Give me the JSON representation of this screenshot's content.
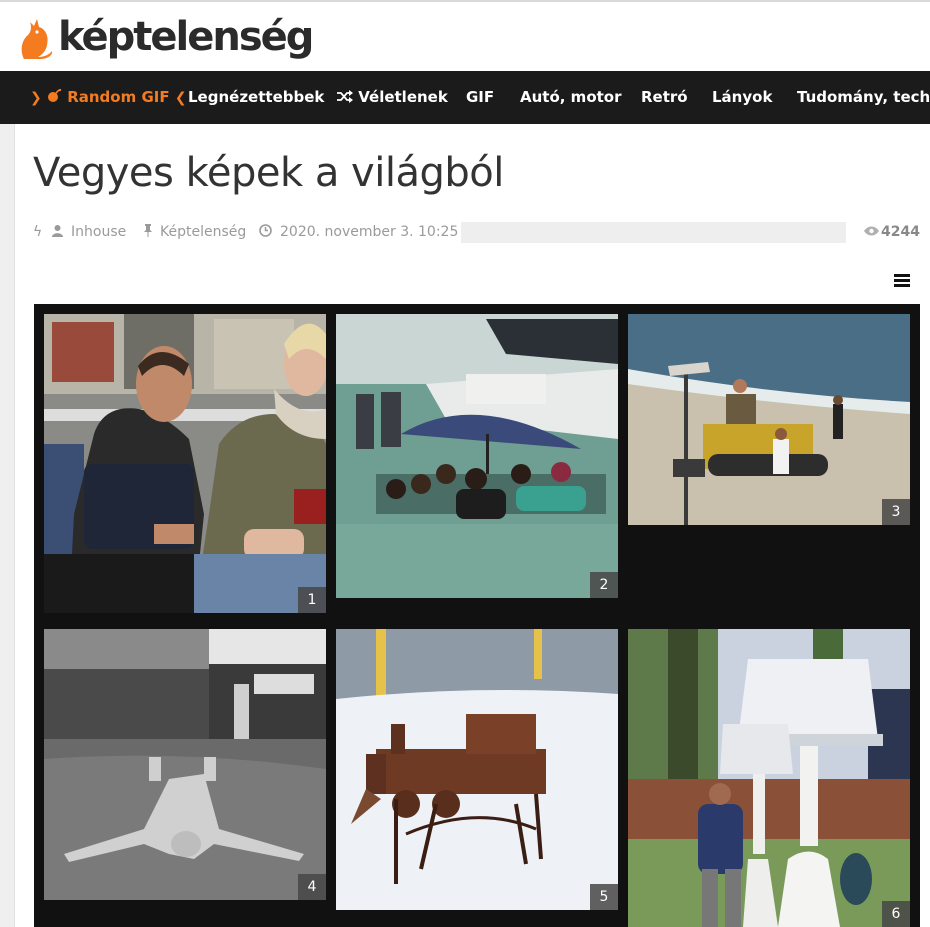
{
  "logo": {
    "text": "képtelenség"
  },
  "nav": {
    "items": [
      {
        "label": "Random GIF",
        "icon": "bomb-icon"
      },
      {
        "label": "Legnézettebbek"
      },
      {
        "label": "Véletlenek",
        "icon": "shuffle-icon"
      },
      {
        "label": "GIF"
      },
      {
        "label": "Autó, motor"
      },
      {
        "label": "Retró"
      },
      {
        "label": "Lányok"
      },
      {
        "label": "Tudomány, techni"
      }
    ],
    "accent_color": "#f47b20"
  },
  "article": {
    "title": "Vegyes képek a világból",
    "author": "Inhouse",
    "category": "Képtelenség",
    "date": "2020. november 3. 10:25",
    "views": "4244"
  },
  "gallery": {
    "photos": [
      {
        "number": "1"
      },
      {
        "number": "2"
      },
      {
        "number": "3"
      },
      {
        "number": "4"
      },
      {
        "number": "5"
      },
      {
        "number": "6"
      }
    ]
  }
}
